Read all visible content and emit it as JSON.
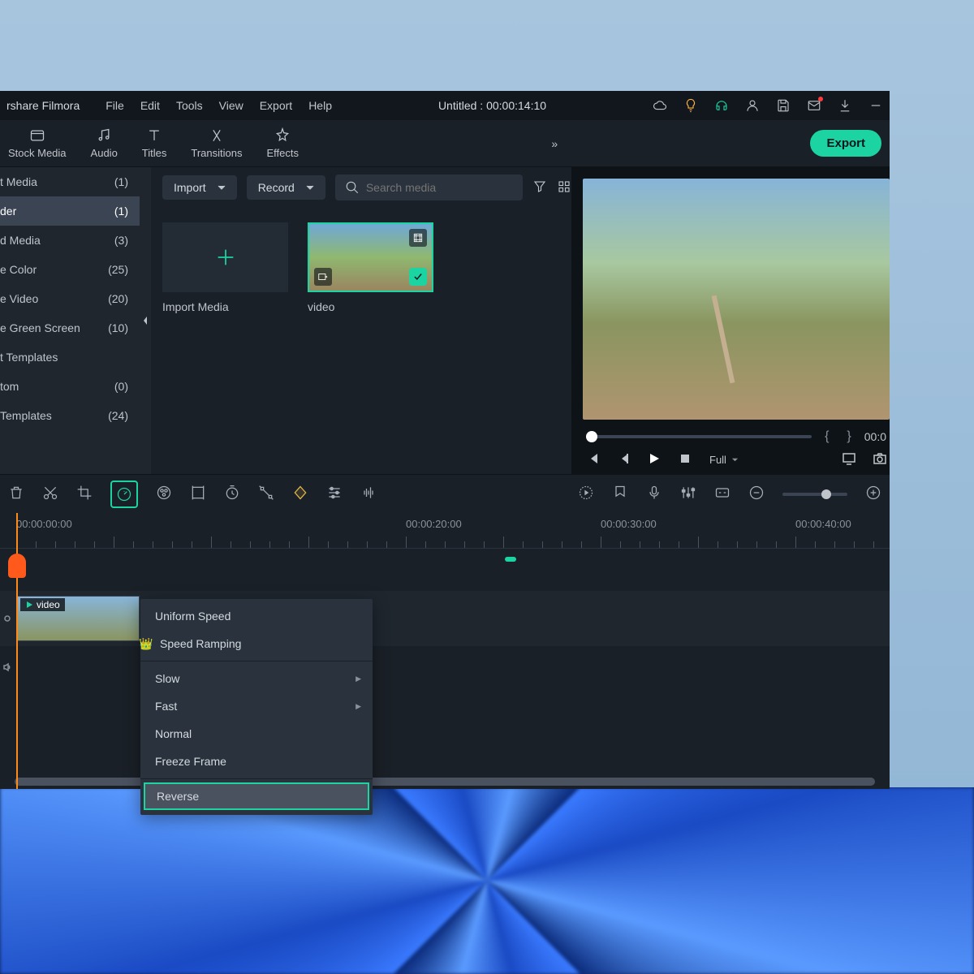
{
  "app": {
    "name": "rshare Filmora"
  },
  "menubar": {
    "items": [
      "File",
      "Edit",
      "Tools",
      "View",
      "Export",
      "Help"
    ]
  },
  "window": {
    "title": "Untitled : 00:00:14:10"
  },
  "titlebar_icons": [
    "cloud",
    "tips",
    "headset",
    "user",
    "save",
    "mail",
    "download",
    "minimize"
  ],
  "main_tabs": [
    "Stock Media",
    "Audio",
    "Titles",
    "Transitions",
    "Effects"
  ],
  "export_label": "Export",
  "sidebar": {
    "items": [
      {
        "label": "t Media",
        "count": "(1)"
      },
      {
        "label": "der",
        "count": "(1)",
        "active": true
      },
      {
        "label": "d Media",
        "count": "(3)"
      },
      {
        "label": "e Color",
        "count": "(25)"
      },
      {
        "label": "e Video",
        "count": "(20)"
      },
      {
        "label": "e Green Screen",
        "count": "(10)"
      },
      {
        "label": "t Templates",
        "count": ""
      },
      {
        "label": "tom",
        "count": "(0)"
      },
      {
        "label": "Templates",
        "count": "(24)"
      }
    ]
  },
  "media_toolbar": {
    "import_label": "Import",
    "record_label": "Record",
    "search_placeholder": "Search media"
  },
  "media_grid": {
    "import_label": "Import Media",
    "clip_name": "video"
  },
  "preview": {
    "time": "00:0",
    "quality": "Full"
  },
  "timeline": {
    "ruler": [
      "00:00:00:00",
      "00:00:20:00",
      "00:00:30:00",
      "00:00:40:00"
    ],
    "clip_label": "video"
  },
  "speed_menu": {
    "items": [
      {
        "label": "Uniform Speed"
      },
      {
        "label": "Speed Ramping",
        "crown": true
      },
      {
        "sep": true
      },
      {
        "label": "Slow",
        "submenu": true
      },
      {
        "label": "Fast",
        "submenu": true
      },
      {
        "label": "Normal"
      },
      {
        "label": "Freeze Frame"
      },
      {
        "sep": true
      },
      {
        "label": "Reverse",
        "highlighted": true
      }
    ]
  }
}
